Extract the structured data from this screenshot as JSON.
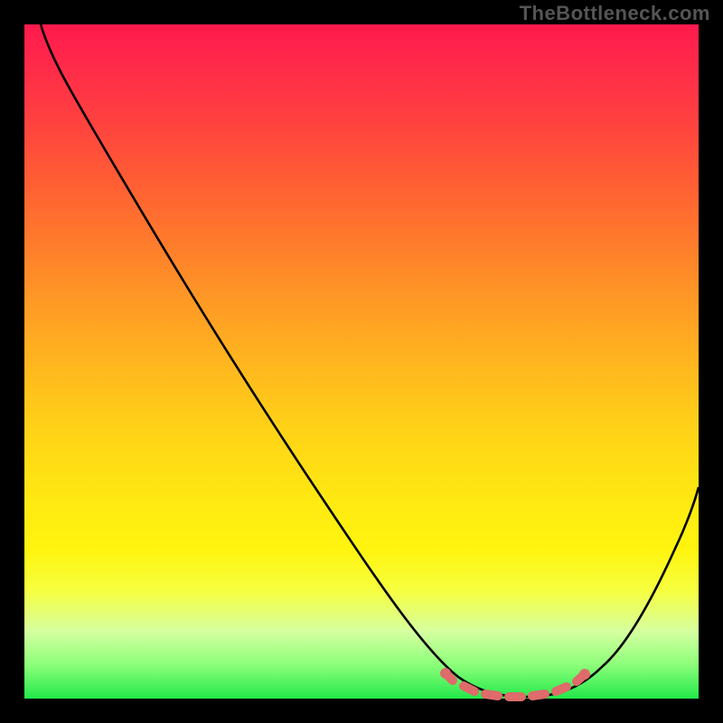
{
  "branding": "TheBottleneck.com",
  "gradient_colors": {
    "top": "#ff1a4d",
    "mid_upper": "#ff7a2c",
    "mid": "#ffd217",
    "mid_lower": "#f6ff40",
    "bottom": "#22e84a"
  },
  "curve_stroke": "#000000",
  "marker_color": "#df6b6b",
  "chart_data": {
    "type": "line",
    "title": "",
    "xlabel": "",
    "ylabel": "",
    "xlim": [
      0,
      100
    ],
    "ylim": [
      0,
      100
    ],
    "series": [
      {
        "name": "curve",
        "x": [
          2,
          5,
          10,
          20,
          30,
          40,
          50,
          58,
          62,
          66,
          70,
          74,
          78,
          82,
          88,
          94,
          100
        ],
        "y": [
          100,
          95,
          88,
          74,
          60,
          46,
          32,
          18,
          10,
          5,
          2,
          1,
          2,
          5,
          14,
          28,
          42
        ]
      }
    ],
    "markers": {
      "name": "highlight",
      "x": [
        62,
        66,
        70,
        74,
        78,
        82
      ],
      "y": [
        10,
        5,
        2,
        1,
        2,
        5
      ]
    },
    "annotations": []
  }
}
